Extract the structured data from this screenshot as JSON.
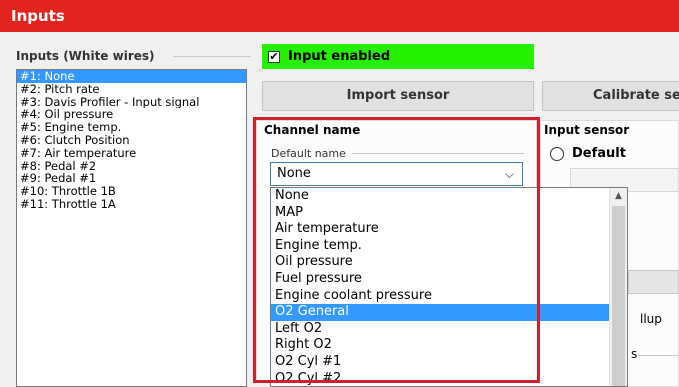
{
  "window": {
    "title": "Inputs"
  },
  "inputs_group": {
    "label": "Inputs (White wires)",
    "items": [
      "#1: None",
      "#2: Pitch rate",
      "#3: Davis Profiler - Input signal",
      "#4: Oil pressure",
      "#5: Engine temp.",
      "#6: Clutch Position",
      "#7: Air temperature",
      "#8: Pedal #2",
      "#9: Pedal #1",
      "#10: Throttle 1B",
      "#11: Throttle 1A"
    ],
    "selected_index": 0
  },
  "input_enabled": {
    "label": "Input enabled",
    "checked": true,
    "check_glyph": "✔"
  },
  "buttons": {
    "import": "Import sensor",
    "calibrate": "Calibrate se"
  },
  "channel": {
    "heading": "Channel name",
    "default_name_label": "Default name",
    "selected_value": "None",
    "options": [
      "None",
      "MAP",
      "Air temperature",
      "Engine temp.",
      "Oil pressure",
      "Fuel pressure",
      "Engine coolant pressure",
      "O2 General",
      "Left O2",
      "Right O2",
      "O2 Cyl #1",
      "O2 Cyl #2"
    ],
    "highlighted_index": 7
  },
  "input_sensor": {
    "heading": "Input sensor",
    "default_option": "Default",
    "fragment_pullup": "llup",
    "fragment_s": "s"
  },
  "colors": {
    "titlebar": "#e2241f",
    "enabled_bg": "#24f000",
    "selection": "#3399ff",
    "highlight_frame": "#d0202e"
  }
}
